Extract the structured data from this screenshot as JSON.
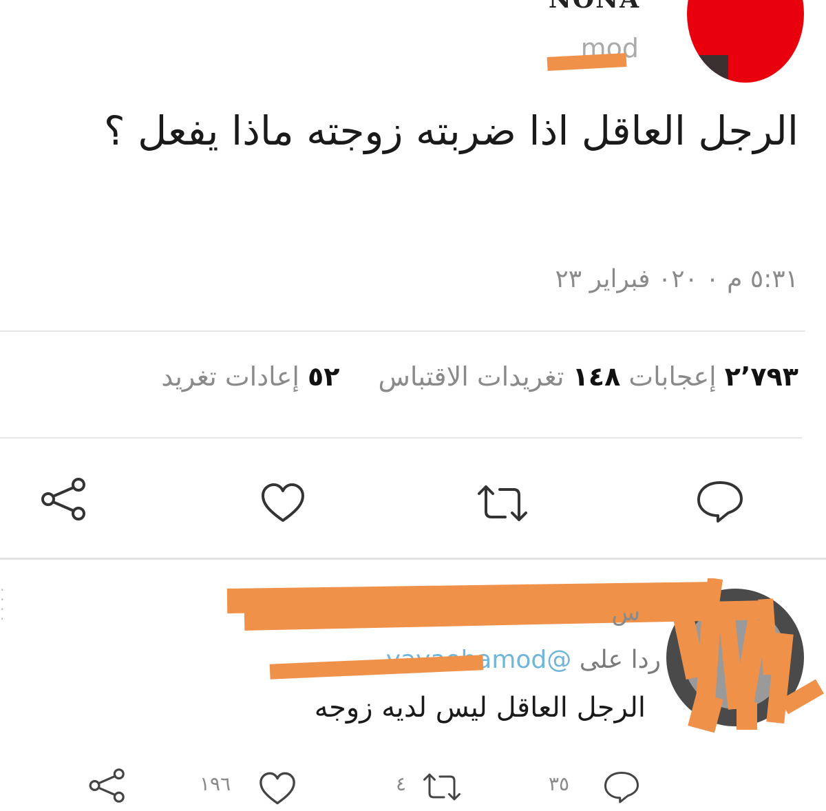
{
  "tweet": {
    "display_name": "NONA",
    "handle": "mod",
    "text": "الرجل العاقل اذا ضربته زوجته ماذا يفعل ؟",
    "timestamp": "٥:٣١ م ٠ ٠٢٠ فبراير ٢٣",
    "stats": {
      "retweets_count": "٥٢",
      "retweets_label": "إعادات تغريد",
      "quotes_count": "١٤٨",
      "quotes_label": "تغريدات الاقتباس",
      "likes_count": "٢٬٧٩٣",
      "likes_label": "إعجابات"
    },
    "actions": [
      "reply-icon",
      "retweet-icon",
      "like-icon",
      "share-icon"
    ]
  },
  "reply": {
    "time": "س",
    "replying_to_label": "ردا على",
    "mention": "@yayaohamod",
    "text": "الرجل العاقل ليس لديه زوجه",
    "counts": {
      "replies": "٣٥",
      "retweets": "٤",
      "likes": "١٩٦"
    }
  },
  "colors": {
    "redaction": "#f0914a",
    "avatar": "#e8000d",
    "muted_text": "#8a8a8a",
    "mention": "#6fb6d9"
  }
}
